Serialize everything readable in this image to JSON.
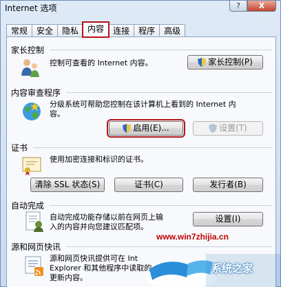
{
  "window": {
    "title": "Internet 选项",
    "help_label": "?",
    "close_label": "X"
  },
  "tabs": [
    {
      "label": "常规"
    },
    {
      "label": "安全"
    },
    {
      "label": "隐私"
    },
    {
      "label": "内容"
    },
    {
      "label": "连接"
    },
    {
      "label": "程序"
    },
    {
      "label": "高级"
    }
  ],
  "parental": {
    "title": "家长控制",
    "description": "控制可查看的 Internet 内容。",
    "button_label": "家长控制(P)"
  },
  "advisor": {
    "title": "内容审查程序",
    "description_line1": "分级系统可帮助您控制在该计算机上看到的 Internet 内",
    "description_line2": "容。",
    "enable_label": "启用(E)...",
    "settings_label": "设置(T)"
  },
  "certificates": {
    "title": "证书",
    "description": "使用加密连接和标识的证书。",
    "clear_ssl_label": "清除 SSL 状态(S)",
    "certs_label": "证书(C)",
    "publishers_label": "发行者(B)"
  },
  "autocomplete": {
    "title": "自动完成",
    "description_line1": "自动完成功能存储以前在网页上输",
    "description_line2": "入的内容并向您建议匹配项。",
    "settings_label": "设置(I)"
  },
  "feeds": {
    "title": "源和网页快讯",
    "description_line1": "源和网页快讯提供可在 Int",
    "description_line2": "Explorer 和其他程序中读取的",
    "description_line3": "更新内容。"
  },
  "watermark": {
    "url": "www.win7zhijia.cn",
    "brand": "系统之家"
  }
}
